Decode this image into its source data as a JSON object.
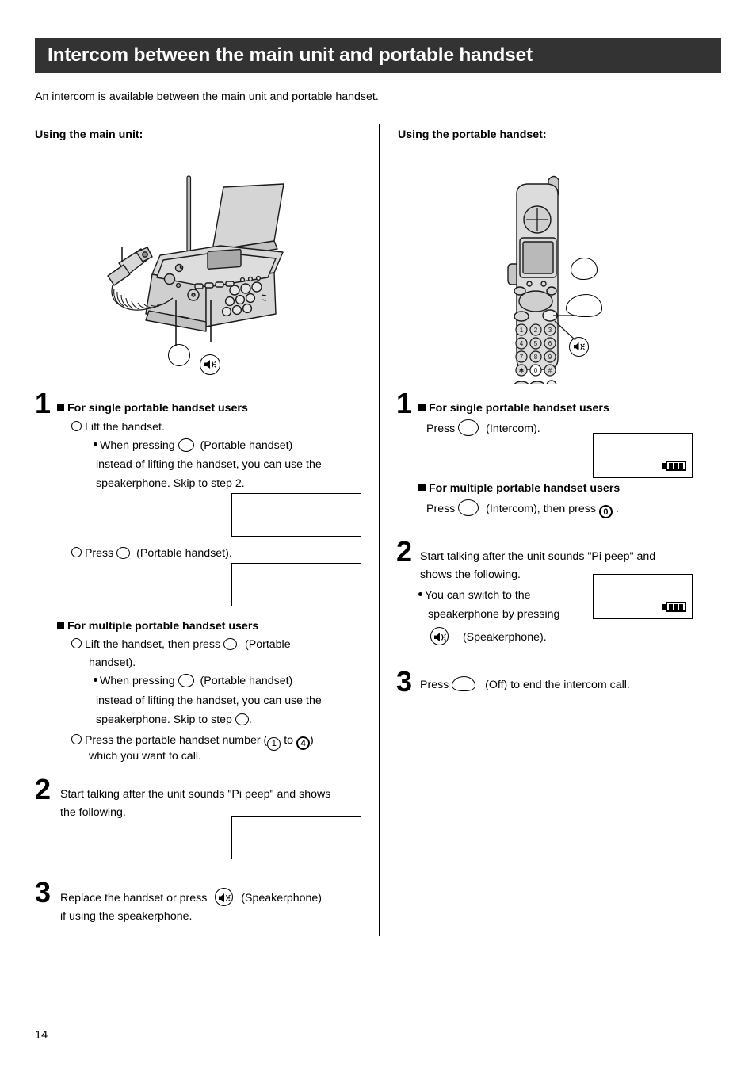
{
  "page": {
    "number": "14",
    "title": "Intercom between the main unit and portable handset",
    "intro": "An intercom is available between the main unit and portable handset.",
    "header_bg": "#333333",
    "header_fg": "#ffffff"
  },
  "columns": {
    "left": {
      "heading": "Using the main unit:",
      "illustration_name": "fax-main-unit-illustration",
      "steps": [
        {
          "num": "1",
          "groups": [
            {
              "group_label": "For single portable handset users",
              "items": [
                {
                  "text": "Lift the handset.",
                  "sub": [
                    "When pressing",
                    "(Portable handset)",
                    "instead of lifting the handset, you can use the",
                    "speakerphone. Skip to step 2."
                  ]
                },
                {
                  "text_before": "Press",
                  "text_after": "(Portable handset)."
                }
              ]
            },
            {
              "group_label": "For multiple portable handset users",
              "items": [
                {
                  "text_before": "Lift the handset, then press",
                  "text_after": "(Portable",
                  "text_cont": "handset).",
                  "sub": [
                    "When pressing",
                    "(Portable handset)",
                    "instead of lifting the handset, you can use the",
                    "speakerphone. Skip to step",
                    "."
                  ]
                },
                {
                  "text_before": "Press the portable handset number (",
                  "key_from": "1",
                  "text_mid": "to",
                  "key_to": "4",
                  "text_after": ")",
                  "text_cont": "which you want to call."
                }
              ]
            }
          ]
        },
        {
          "num": "2",
          "line1": "Start talking after the unit sounds \"Pi peep\" and shows",
          "line2": "the following."
        },
        {
          "num": "3",
          "line1_before": "Replace the handset or press",
          "line1_after": "(Speakerphone)",
          "line2": "if using the speakerphone."
        }
      ]
    },
    "right": {
      "heading": "Using the portable handset:",
      "illustration_name": "portable-handset-illustration",
      "steps": [
        {
          "num": "1",
          "groups": [
            {
              "group_label": "For single portable handset users",
              "press_before": "Press",
              "press_after": "(Intercom)."
            },
            {
              "group_label": "For multiple portable handset users",
              "press_before": "Press",
              "press_mid": "(Intercom), then press",
              "key_zero": "0",
              "press_after": "."
            }
          ]
        },
        {
          "num": "2",
          "line1": "Start talking after the unit sounds \"Pi peep\" and",
          "line2": "shows the following.",
          "sub1": "You can switch to the",
          "sub2": "speakerphone by pressing",
          "sub3": "(Speakerphone)."
        },
        {
          "num": "3",
          "line1_before": "Press",
          "line1_after": "(Off) to end the intercom call."
        }
      ]
    }
  },
  "icons": {
    "speakerphone": "speakerphone-icon",
    "battery": "battery-full-icon"
  }
}
